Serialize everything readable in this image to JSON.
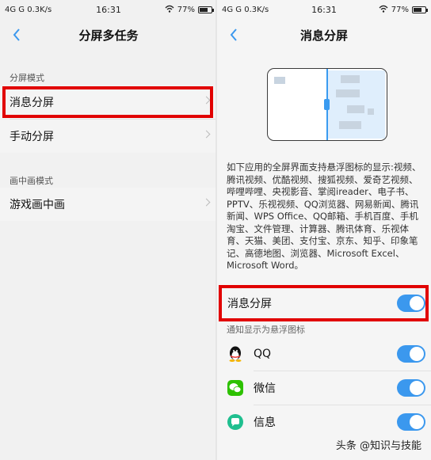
{
  "colors": {
    "accent": "#3b98ee",
    "highlight": "#e10000",
    "background": "#f1f1f1",
    "toggle_knob": "#ffffff"
  },
  "left": {
    "status": {
      "network": "4G  G  0.3K/s",
      "time": "16:31",
      "battery": "77%",
      "battery_level": 0.77
    },
    "title": "分屏多任务",
    "sections": [
      {
        "label": "分屏模式",
        "items": [
          {
            "label": "消息分屏"
          },
          {
            "label": "手动分屏"
          }
        ]
      },
      {
        "label": "画中画模式",
        "items": [
          {
            "label": "游戏画中画"
          }
        ]
      }
    ]
  },
  "right": {
    "status": {
      "network": "4G  G  0.3K/s",
      "time": "16:31",
      "battery": "77%",
      "battery_level": 0.77
    },
    "title": "消息分屏",
    "description": "如下应用的全屏界面支持悬浮图标的显示:视频、腾讯视频、优酷视频、搜狐视频、爱奇艺视频、哔哩哔哩、央视影音、掌阅ireader、电子书、PPTV、乐视视频、QQ浏览器、网易新闻、腾讯新闻、WPS Office、QQ邮箱、手机百度、手机淘宝、文件管理、计算器、腾讯体育、乐视体育、天猫、美团、支付宝、京东、知乎、印象笔记、高德地图、浏览器、Microsoft Excel、Microsoft Word。",
    "master_toggle": {
      "label": "消息分屏",
      "on": true
    },
    "notify_label": "通知显示为悬浮图标",
    "apps": [
      {
        "label": "QQ",
        "icon": "qq-penguin-icon",
        "on": true
      },
      {
        "label": "微信",
        "icon": "wechat-icon",
        "on": true
      },
      {
        "label": "信息",
        "icon": "messages-icon",
        "on": true
      }
    ]
  },
  "watermark": "头条 @知识与技能"
}
